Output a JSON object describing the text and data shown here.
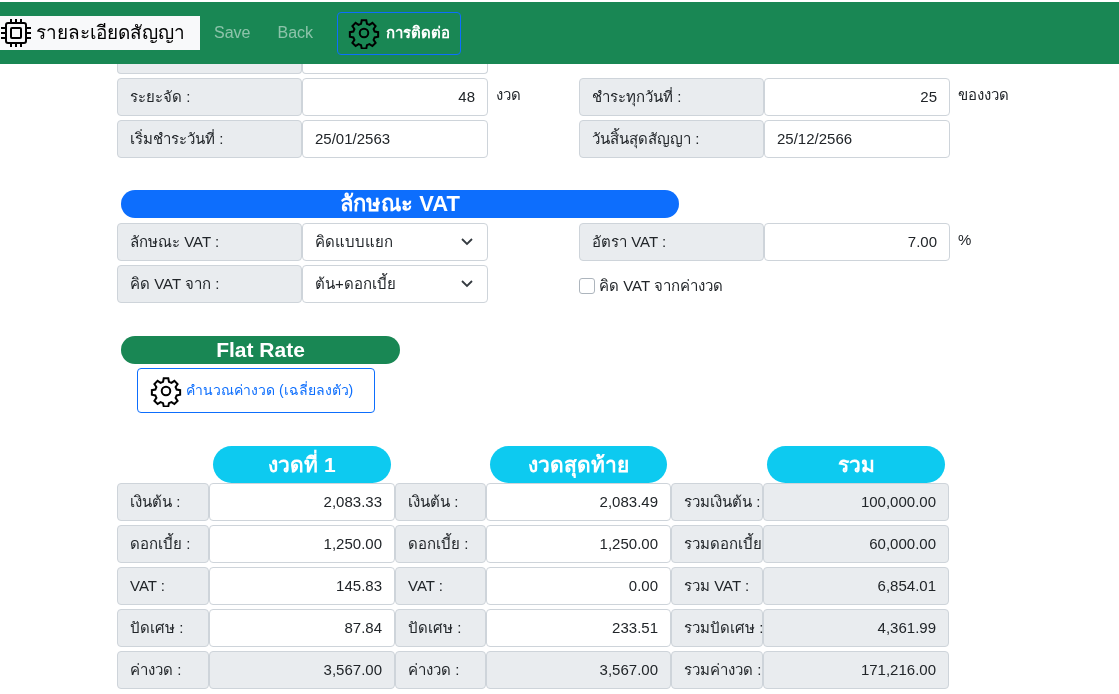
{
  "navbar": {
    "brand": "รายละเอียดสัญญา",
    "links": [
      {
        "label": "Save",
        "disabled": true
      },
      {
        "label": "Back",
        "disabled": true
      }
    ],
    "contact_button": "การติดต่อ"
  },
  "contract_fields": {
    "left": [
      {
        "kind": "number",
        "label": "ระยะจัด :",
        "value": "48",
        "suffix": "งวด"
      },
      {
        "kind": "date",
        "label": "เริ่มชำระวันที่ :",
        "value": "25/01/2563"
      }
    ],
    "right": [
      {
        "kind": "number",
        "label": "ชำระทุกวันที่ :",
        "value": "25",
        "suffix": "ของงวด"
      },
      {
        "kind": "date",
        "label": "วันสิ้นสุดสัญญา :",
        "value": "25/12/2566"
      }
    ]
  },
  "vat_section": {
    "heading": "ลักษณะ VAT",
    "left": [
      {
        "kind": "select",
        "label": "ลักษณะ VAT :",
        "value": "คิดแบบแยก"
      },
      {
        "kind": "select",
        "label": "คิด VAT จาก :",
        "value": "ต้น+ดอกเบี้ย"
      }
    ],
    "right": [
      {
        "kind": "number",
        "label": "อัตรา VAT :",
        "value": "7.00",
        "suffix": "%"
      },
      {
        "kind": "checkbox",
        "label": "คิด VAT จากค่างวด",
        "checked": false
      }
    ]
  },
  "flat_rate": {
    "heading": "Flat Rate",
    "calc_button": "คำนวณค่างวด (เฉลี่ยลงตัว)"
  },
  "summary": [
    {
      "heading": "งวดที่ 1",
      "rows": [
        {
          "label": "เงินต้น :",
          "value": "2,083.33",
          "readonly": false
        },
        {
          "label": "ดอกเบี้ย :",
          "value": "1,250.00",
          "readonly": false
        },
        {
          "label": "VAT :",
          "value": "145.83",
          "readonly": false
        },
        {
          "label": "ปัดเศษ :",
          "value": "87.84",
          "readonly": false
        },
        {
          "label": "ค่างวด :",
          "value": "3,567.00",
          "readonly": true
        }
      ]
    },
    {
      "heading": "งวดสุดท้าย",
      "rows": [
        {
          "label": "เงินต้น :",
          "value": "2,083.49",
          "readonly": false
        },
        {
          "label": "ดอกเบี้ย :",
          "value": "1,250.00",
          "readonly": false
        },
        {
          "label": "VAT :",
          "value": "0.00",
          "readonly": false
        },
        {
          "label": "ปัดเศษ :",
          "value": "233.51",
          "readonly": false
        },
        {
          "label": "ค่างวด :",
          "value": "3,567.00",
          "readonly": true
        }
      ]
    },
    {
      "heading": "รวม",
      "rows": [
        {
          "label": "รวมเงินต้น :",
          "value": "100,000.00",
          "readonly": true
        },
        {
          "label": "รวมดอกเบี้ย",
          "value": "60,000.00",
          "readonly": true
        },
        {
          "label": "รวม VAT :",
          "value": "6,854.01",
          "readonly": true
        },
        {
          "label": "รวมปัดเศษ :",
          "value": "4,361.99",
          "readonly": true
        },
        {
          "label": "รวมค่างวด :",
          "value": "171,216.00",
          "readonly": true
        }
      ]
    }
  ]
}
